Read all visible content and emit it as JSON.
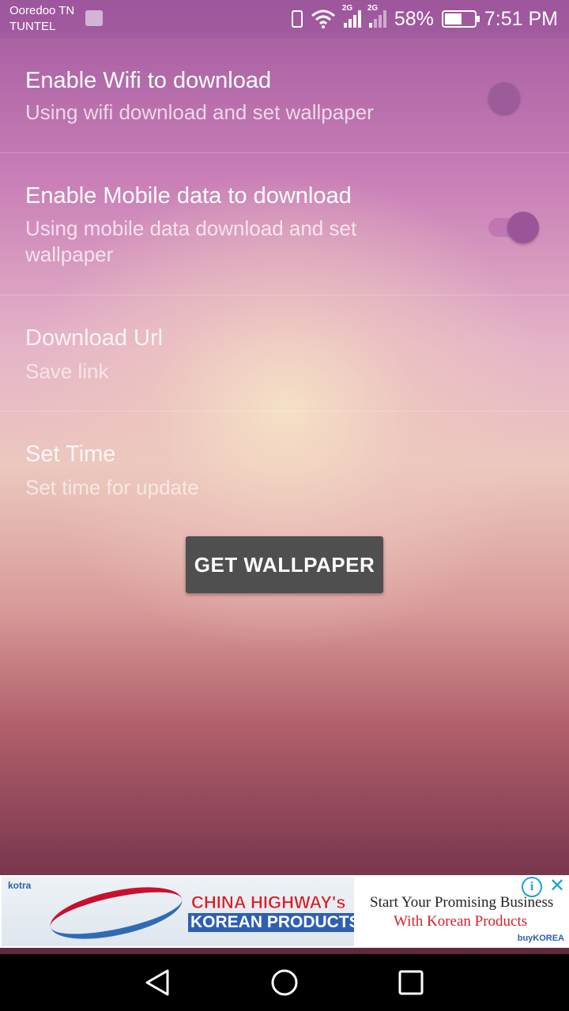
{
  "status_bar": {
    "carrier_line1": "Ooredoo TN",
    "carrier_line2": "TUNTEL",
    "network1": "2G",
    "network2": "2G",
    "battery_percent": "58%",
    "battery_level": 0.58,
    "time": "7:51 PM",
    "icons": [
      "gallery-icon",
      "vibrate-icon",
      "wifi-icon",
      "signal-icon",
      "battery-icon"
    ]
  },
  "preferences": [
    {
      "title": "Enable Wifi to download",
      "summary": "Using wifi download and set wallpaper",
      "switch": "off"
    },
    {
      "title": "Enable Mobile data to download",
      "summary": "Using mobile data download and set wallpaper",
      "switch": "on"
    },
    {
      "title": "Download Url",
      "summary": "Save link"
    },
    {
      "title": "Set Time",
      "summary": "Set time for update"
    }
  ],
  "action_button": {
    "label": "GET WALLPAPER"
  },
  "ad_banner": {
    "brand": "kotra",
    "headline1": "CHINA HIGHWAY's",
    "headline2": "KOREAN PRODUCTS",
    "right_line1": "Start Your Promising Business",
    "right_line2": "With Korean Products",
    "right_brand": "buyKOREA",
    "info_glyph": "i",
    "close_glyph": "✕"
  },
  "nav_bar": {
    "buttons": [
      "back",
      "home",
      "recents"
    ]
  }
}
